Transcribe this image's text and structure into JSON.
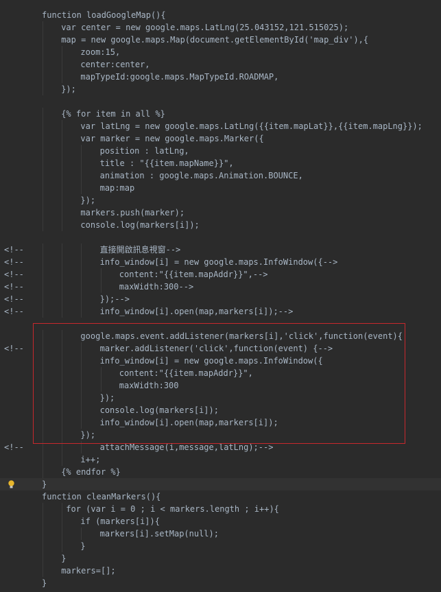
{
  "editor": {
    "current_line_index": 38,
    "lines": [
      {
        "prefix": "",
        "indent": 4,
        "text": "function loadGoogleMap(){"
      },
      {
        "prefix": "",
        "indent": 8,
        "text": "var center = new google.maps.LatLng(25.043152,121.515025);"
      },
      {
        "prefix": "",
        "indent": 8,
        "text": "map = new google.maps.Map(document.getElementById('map_div'),{"
      },
      {
        "prefix": "",
        "indent": 12,
        "text": "zoom:15,"
      },
      {
        "prefix": "",
        "indent": 12,
        "text": "center:center,"
      },
      {
        "prefix": "",
        "indent": 12,
        "text": "mapTypeId:google.maps.MapTypeId.ROADMAP,"
      },
      {
        "prefix": "",
        "indent": 8,
        "text": "});"
      },
      {
        "prefix": "",
        "indent": 0,
        "text": ""
      },
      {
        "prefix": "",
        "indent": 8,
        "text": "{% for item in all %}"
      },
      {
        "prefix": "",
        "indent": 12,
        "text": "var latLng = new google.maps.LatLng({{item.mapLat}},{{item.mapLng}});"
      },
      {
        "prefix": "",
        "indent": 12,
        "text": "var marker = new google.maps.Marker({"
      },
      {
        "prefix": "",
        "indent": 16,
        "text": "position : latLng,"
      },
      {
        "prefix": "",
        "indent": 16,
        "text": "title : \"{{item.mapName}}\","
      },
      {
        "prefix": "",
        "indent": 16,
        "text": "animation : google.maps.Animation.BOUNCE,"
      },
      {
        "prefix": "",
        "indent": 16,
        "text": "map:map"
      },
      {
        "prefix": "",
        "indent": 12,
        "text": "});"
      },
      {
        "prefix": "",
        "indent": 12,
        "text": "markers.push(marker);"
      },
      {
        "prefix": "",
        "indent": 12,
        "text": "console.log(markers[i]);"
      },
      {
        "prefix": "",
        "indent": 0,
        "text": ""
      },
      {
        "prefix": "<!--",
        "indent": 16,
        "text": "直接開啟訊息視窗-->"
      },
      {
        "prefix": "<!--",
        "indent": 16,
        "text": "info_window[i] = new google.maps.InfoWindow({-->"
      },
      {
        "prefix": "<!--",
        "indent": 20,
        "text": "content:\"{{item.mapAddr}}\",-->"
      },
      {
        "prefix": "<!--",
        "indent": 20,
        "text": "maxWidth:300-->"
      },
      {
        "prefix": "<!--",
        "indent": 16,
        "text": "});-->"
      },
      {
        "prefix": "<!--",
        "indent": 16,
        "text": "info_window[i].open(map,markers[i]);-->"
      },
      {
        "prefix": "",
        "indent": 0,
        "text": ""
      },
      {
        "prefix": "",
        "indent": 12,
        "text": "google.maps.event.addListener(markers[i],'click',function(event){"
      },
      {
        "prefix": "<!--",
        "indent": 16,
        "text": "marker.addListener('click',function(event) {-->"
      },
      {
        "prefix": "",
        "indent": 16,
        "text": "info_window[i] = new google.maps.InfoWindow({"
      },
      {
        "prefix": "",
        "indent": 20,
        "text": "content:\"{{item.mapAddr}}\","
      },
      {
        "prefix": "",
        "indent": 20,
        "text": "maxWidth:300"
      },
      {
        "prefix": "",
        "indent": 16,
        "text": "});"
      },
      {
        "prefix": "",
        "indent": 16,
        "text": "console.log(markers[i]);"
      },
      {
        "prefix": "",
        "indent": 16,
        "text": "info_window[i].open(map,markers[i]);"
      },
      {
        "prefix": "",
        "indent": 12,
        "text": "});"
      },
      {
        "prefix": "<!--",
        "indent": 16,
        "text": "attachMessage(i,message,latLng);-->"
      },
      {
        "prefix": "",
        "indent": 12,
        "text": "i++;"
      },
      {
        "prefix": "",
        "indent": 8,
        "text": "{% endfor %}"
      },
      {
        "prefix": "",
        "indent": 4,
        "text": "}"
      },
      {
        "prefix": "",
        "indent": 4,
        "text": "function cleanMarkers(){"
      },
      {
        "prefix": "",
        "indent": 9,
        "text": "for (var i = 0 ; i < markers.length ; i++){"
      },
      {
        "prefix": "",
        "indent": 12,
        "text": "if (markers[i]){"
      },
      {
        "prefix": "",
        "indent": 16,
        "text": "markers[i].setMap(null);"
      },
      {
        "prefix": "",
        "indent": 12,
        "text": "}"
      },
      {
        "prefix": "",
        "indent": 8,
        "text": "}"
      },
      {
        "prefix": "",
        "indent": 8,
        "text": "markers=[];"
      },
      {
        "prefix": "",
        "indent": 4,
        "text": "}"
      }
    ]
  },
  "colors": {
    "background": "#2b2b2b",
    "text": "#a9b7c6",
    "current_line": "#323232",
    "highlight_box": "#c8282d",
    "bulb": "#e8b62c"
  },
  "icons": {
    "gutter": "lightbulb-icon"
  }
}
